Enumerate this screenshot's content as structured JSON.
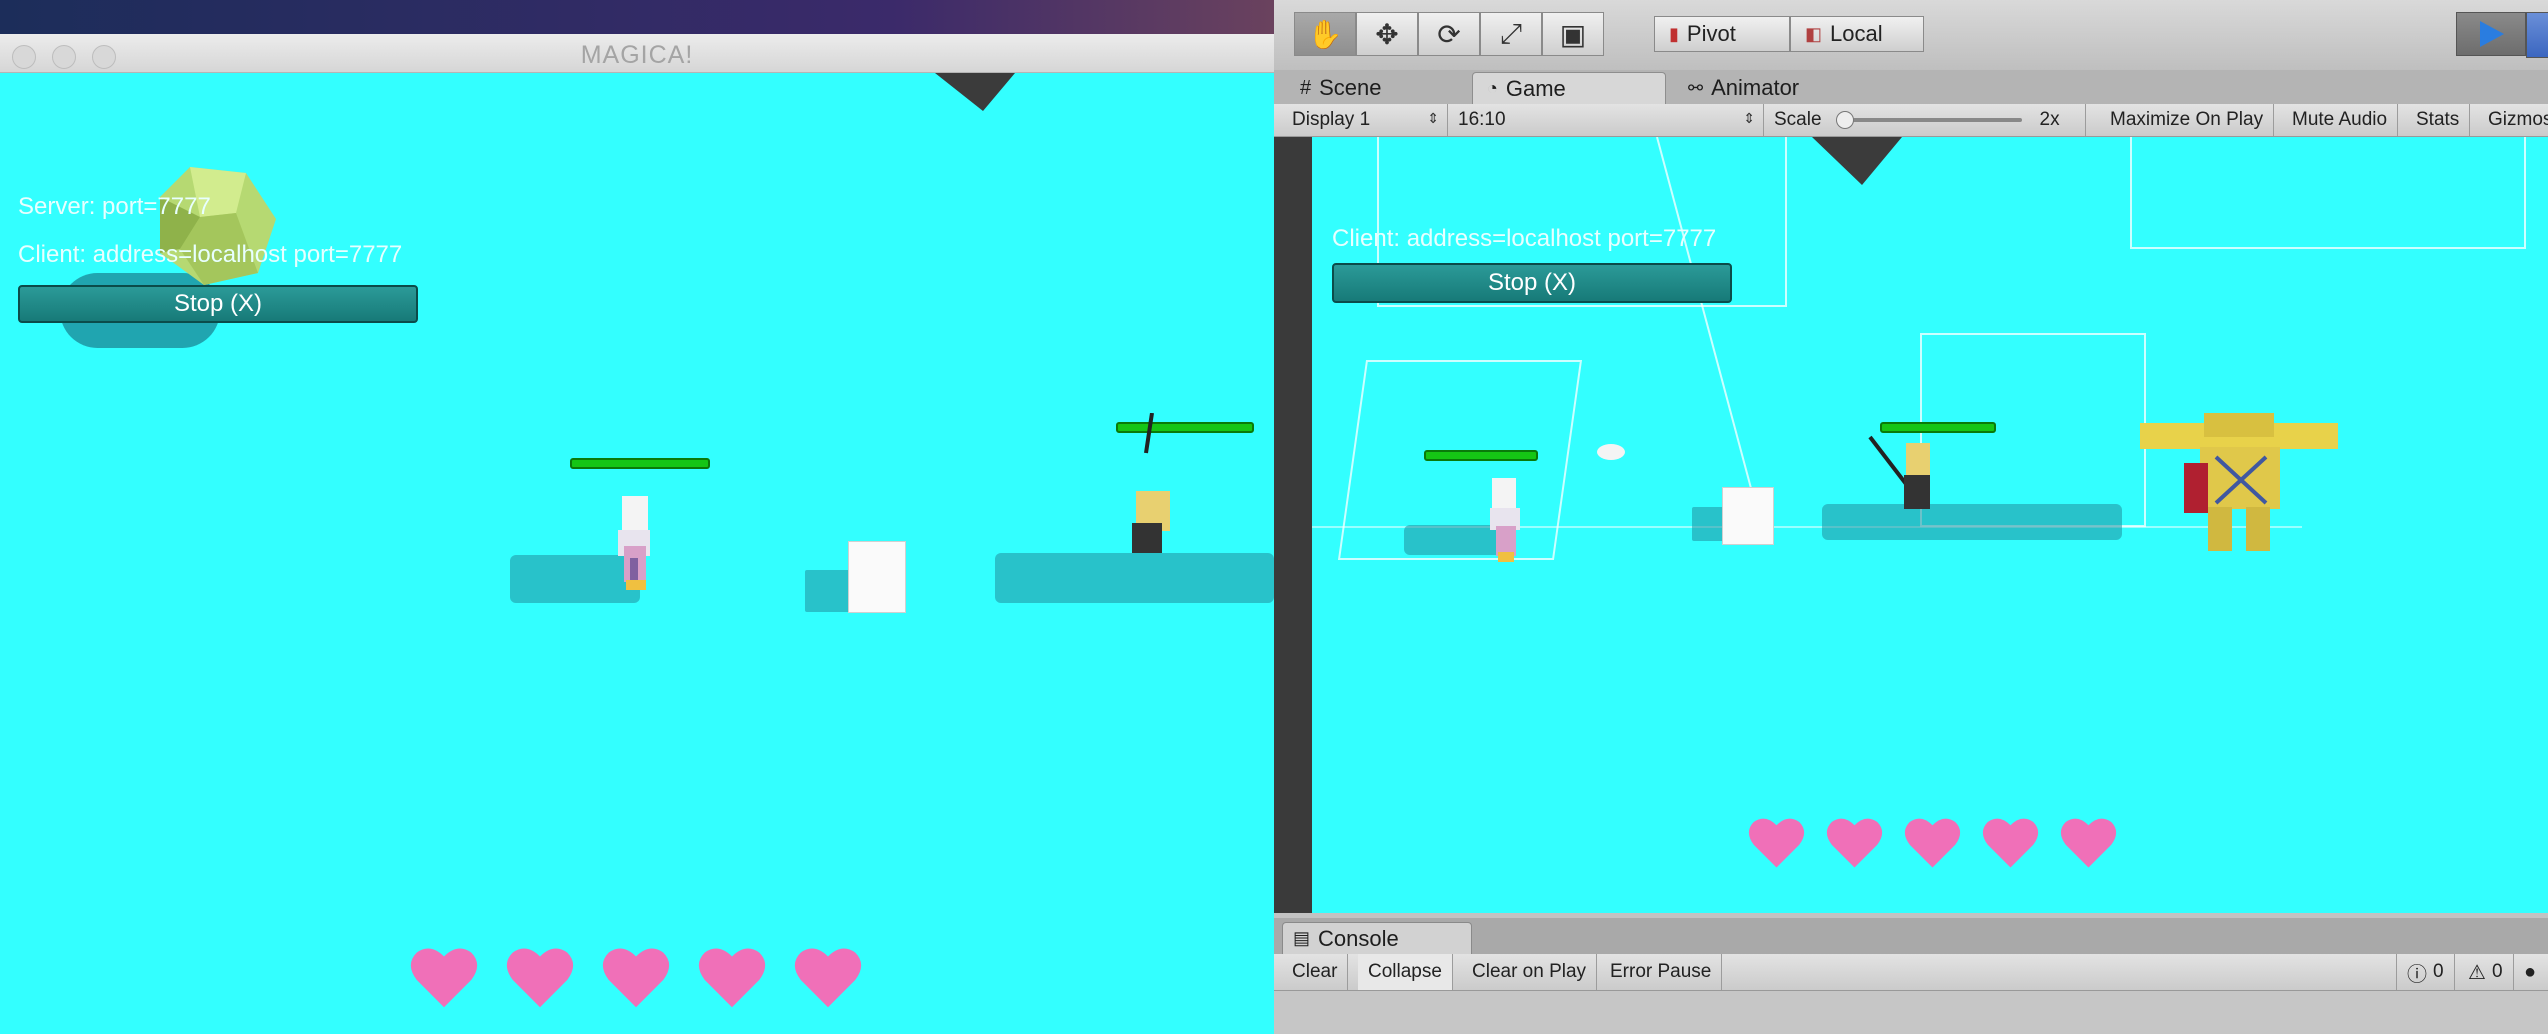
{
  "game_window": {
    "title": "MAGICA!",
    "server_text": "Server: port=7777",
    "client_text": "Client: address=localhost port=7777",
    "stop_label": "Stop (X)",
    "hearts": 5
  },
  "unity": {
    "tools": [
      "hand-tool-icon",
      "move-tool-icon",
      "rotate-tool-icon",
      "scale-tool-icon",
      "rect-tool-icon"
    ],
    "pivot_label": "Pivot",
    "local_label": "Local",
    "tabs": {
      "scene": "Scene",
      "game": "Game",
      "animator": "Animator"
    },
    "game_toolbar": {
      "display": "Display 1",
      "aspect": "16:10",
      "scale_label": "Scale",
      "scale_value": "2x",
      "maximize": "Maximize On Play",
      "mute": "Mute Audio",
      "stats": "Stats",
      "gizmos": "Gizmos"
    },
    "game_view": {
      "client_text": "Client: address=localhost port=7777",
      "stop_label": "Stop (X)",
      "hearts": 5
    },
    "console": {
      "tab": "Console",
      "clear": "Clear",
      "collapse": "Collapse",
      "clear_on_play": "Clear on Play",
      "error_pause": "Error Pause",
      "info_count": "0",
      "warning_count": "0"
    }
  },
  "colors": {
    "sky": "#33ffff",
    "heart": "#f070b8",
    "health": "#15c515",
    "play_accent": "#2a7de0"
  }
}
